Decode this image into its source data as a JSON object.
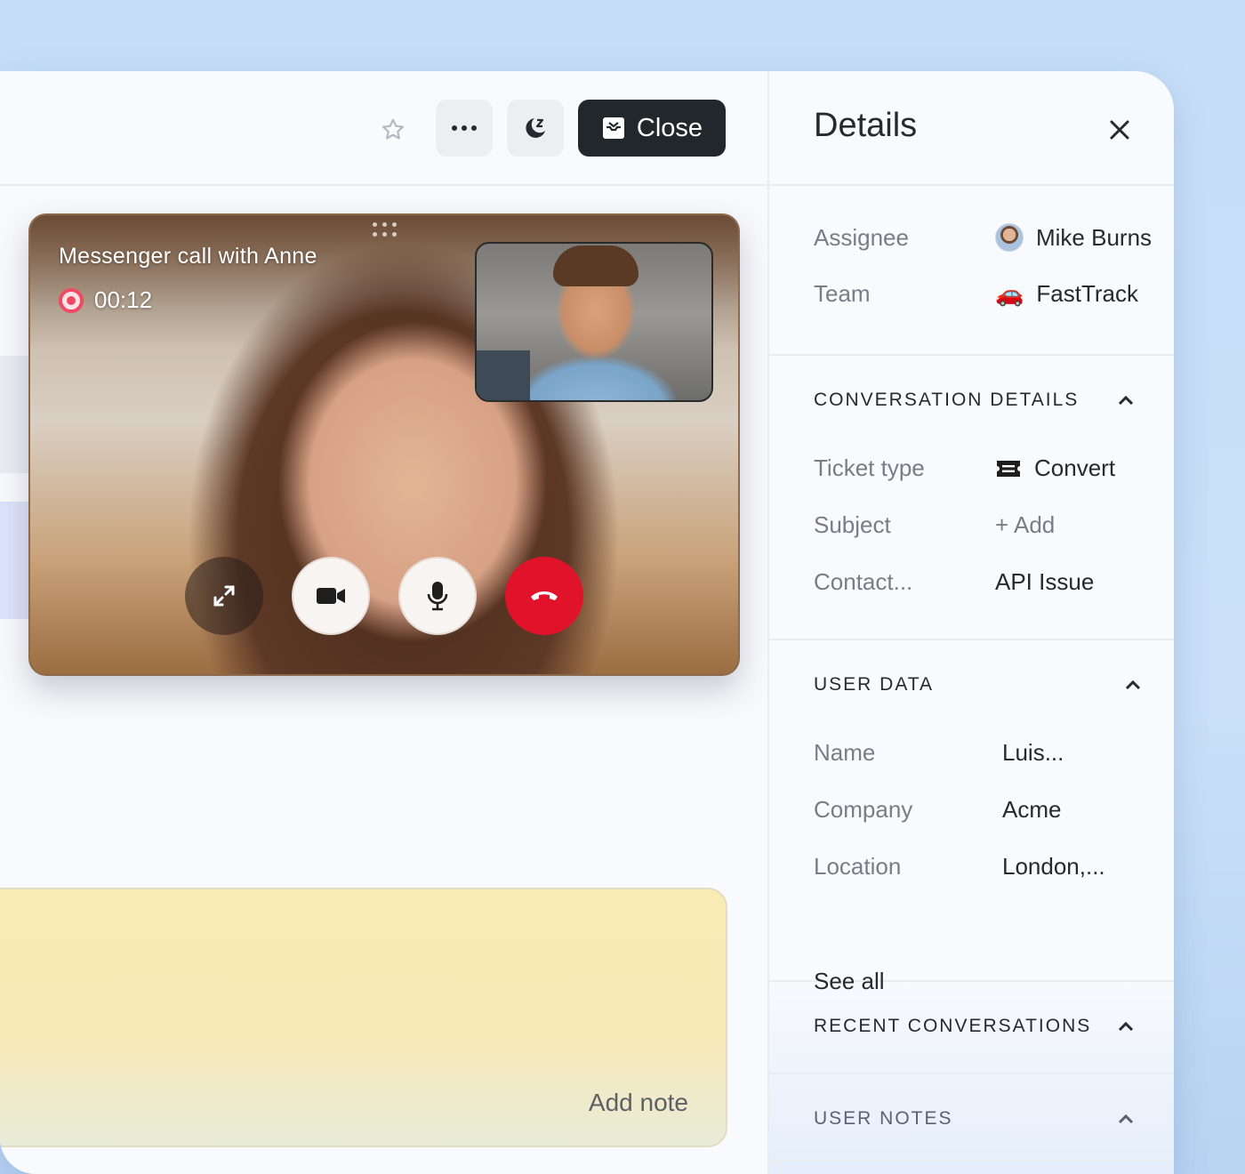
{
  "toolbar": {
    "close_label": "Close",
    "star_icon": "star-icon",
    "more_icon": "more-icon",
    "snooze_icon": "snooze-icon"
  },
  "call": {
    "title": "Messenger call with Anne",
    "timer": "00:12",
    "controls": [
      "expand-icon",
      "video-camera-icon",
      "microphone-icon",
      "end-call-icon"
    ],
    "end_color": "#e1132b"
  },
  "note": {
    "label": "Add note"
  },
  "details": {
    "title": "Details",
    "assignee_label": "Assignee",
    "assignee_value": "Mike Burns",
    "team_label": "Team",
    "team_value": "FastTrack",
    "team_icon": "🚗",
    "conversation": {
      "heading": "CONVERSATION DETAILS",
      "rows": [
        {
          "label": "Ticket type",
          "value": "Convert"
        },
        {
          "label": "Subject",
          "value": "+ Add"
        },
        {
          "label": "Contact...",
          "value": "API Issue"
        }
      ]
    },
    "user_data": {
      "heading": "USER DATA",
      "rows": [
        {
          "label": "Name",
          "value": "Luis..."
        },
        {
          "label": "Company",
          "value": "Acme"
        },
        {
          "label": "Location",
          "value": "London,..."
        }
      ],
      "see_all": "See all"
    },
    "recent_heading": "RECENT CONVERSATIONS",
    "notes_heading": "USER NOTES"
  },
  "colors": {
    "background": "#c6def8",
    "panel": "#f8fafd",
    "primary_button": "#22272b",
    "note": "#f9ebb4",
    "record": "#f04a63"
  }
}
